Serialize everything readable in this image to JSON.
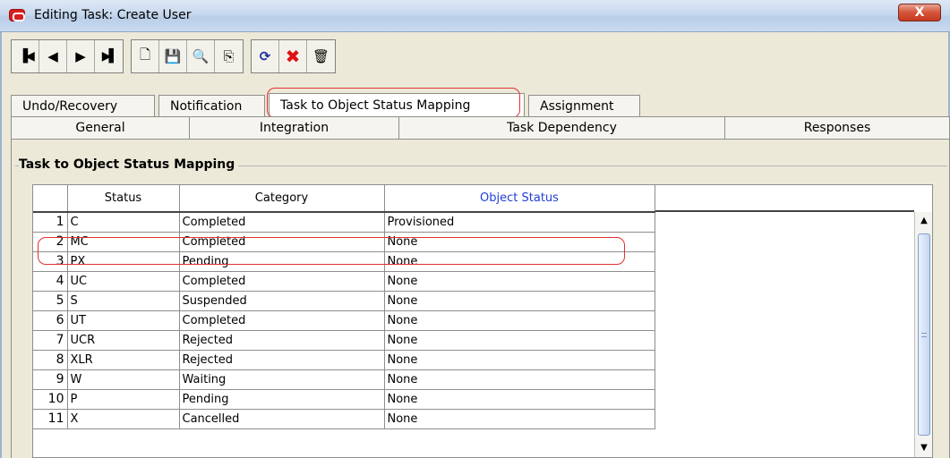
{
  "window": {
    "title": "Editing Task: Create User",
    "close_label": "X"
  },
  "toolbar": {
    "nav": [
      {
        "name": "first-record-icon",
        "glyph": "▐◀"
      },
      {
        "name": "previous-record-icon",
        "glyph": "◀"
      },
      {
        "name": "next-record-icon",
        "glyph": "▶"
      },
      {
        "name": "last-record-icon",
        "glyph": "▶▌"
      }
    ],
    "actions": [
      {
        "name": "new-icon",
        "glyph": "🗋"
      },
      {
        "name": "save-icon",
        "glyph": "💾"
      },
      {
        "name": "find-icon",
        "glyph": "🔍"
      },
      {
        "name": "assign-icon",
        "glyph": "⎘"
      }
    ],
    "edit": [
      {
        "name": "refresh-icon",
        "glyph": "⟳"
      },
      {
        "name": "cancel-icon",
        "glyph": "✖"
      },
      {
        "name": "delete-icon",
        "glyph": "🗑"
      }
    ]
  },
  "tabs": {
    "row1": [
      "Undo/Recovery",
      "Notification",
      "Task to Object Status Mapping",
      "Assignment"
    ],
    "row2": [
      "General",
      "Integration",
      "Task Dependency",
      "Responses"
    ],
    "active": "Task to Object Status Mapping"
  },
  "panel": {
    "title": "Task to Object Status Mapping"
  },
  "table": {
    "columns": [
      "Status",
      "Category",
      "Object Status"
    ],
    "rows": [
      {
        "num": "1",
        "status": "C",
        "category": "Completed",
        "object_status": "Provisioned"
      },
      {
        "num": "2",
        "status": "MC",
        "category": "Completed",
        "object_status": "None"
      },
      {
        "num": "3",
        "status": "PX",
        "category": "Pending",
        "object_status": "None"
      },
      {
        "num": "4",
        "status": "UC",
        "category": "Completed",
        "object_status": "None"
      },
      {
        "num": "5",
        "status": "S",
        "category": "Suspended",
        "object_status": "None"
      },
      {
        "num": "6",
        "status": "UT",
        "category": "Completed",
        "object_status": "None"
      },
      {
        "num": "7",
        "status": "UCR",
        "category": "Rejected",
        "object_status": "None"
      },
      {
        "num": "8",
        "status": "XLR",
        "category": "Rejected",
        "object_status": "None"
      },
      {
        "num": "9",
        "status": "W",
        "category": "Waiting",
        "object_status": "None"
      },
      {
        "num": "10",
        "status": "P",
        "category": "Pending",
        "object_status": "None"
      },
      {
        "num": "11",
        "status": "X",
        "category": "Cancelled",
        "object_status": "None"
      }
    ]
  },
  "colors": {
    "highlight": "#e53030",
    "object_status_header": "#1f3fd6",
    "cancel_icon": "#e01010",
    "save_icon": "#1d2fa0"
  }
}
